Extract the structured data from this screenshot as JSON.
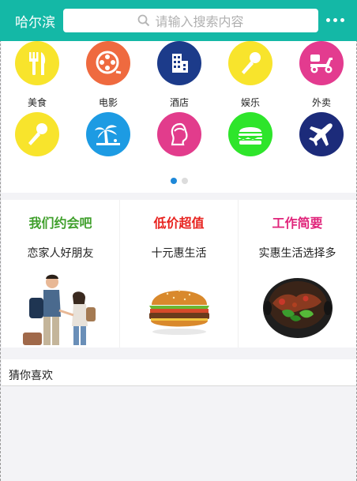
{
  "header": {
    "city": "哈尔滨",
    "search_placeholder": "请输入搜索内容",
    "background_color": "#14b8a6"
  },
  "categories": [
    {
      "label": "美食",
      "icon": "fork-knife-icon",
      "color": "#f8e42c"
    },
    {
      "label": "电影",
      "icon": "film-reel-icon",
      "color": "#ef6a3f"
    },
    {
      "label": "酒店",
      "icon": "building-icon",
      "color": "#1c3b8a"
    },
    {
      "label": "娱乐",
      "icon": "microphone-icon",
      "color": "#f8e42c"
    },
    {
      "label": "外卖",
      "icon": "scooter-icon",
      "color": "#e33b8f"
    },
    {
      "label": "",
      "icon": "microphone-icon",
      "color": "#f8e42c"
    },
    {
      "label": "",
      "icon": "palm-tree-icon",
      "color": "#1d9be3"
    },
    {
      "label": "",
      "icon": "woman-head-icon",
      "color": "#e23c8c"
    },
    {
      "label": "",
      "icon": "burger-icon",
      "color": "#2ee52b"
    },
    {
      "label": "",
      "icon": "airplane-icon",
      "color": "#1c2b7a"
    }
  ],
  "pagination": {
    "active_page": 1,
    "pages": 2,
    "active_color": "#1e88d8"
  },
  "promos": [
    {
      "title": "我们约会吧",
      "subtitle": "恋家人好朋友",
      "title_color": "#3f9f2b",
      "image": "couple-photo"
    },
    {
      "title": "低价超值",
      "subtitle": "十元惠生活",
      "title_color": "#e8231f",
      "image": "burger-photo"
    },
    {
      "title": "工作简要",
      "subtitle": "实惠生活选择多",
      "title_color": "#e0257b",
      "image": "clay-pot-dish-photo"
    }
  ],
  "guess": {
    "label": "猜你喜欢"
  }
}
